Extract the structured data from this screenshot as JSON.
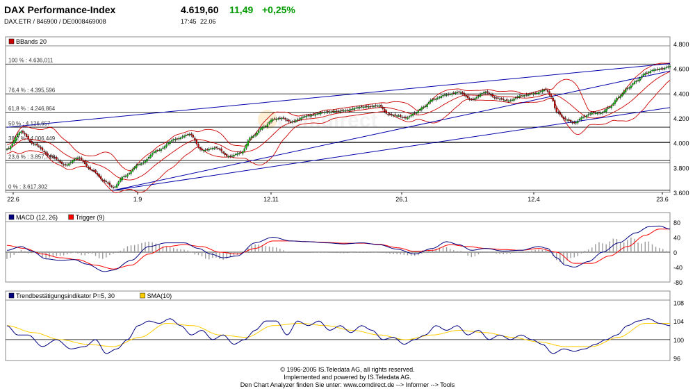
{
  "header": {
    "title": "DAX Performance-Index",
    "price": "4.619,60",
    "change": "11,49",
    "change_pct": "+0,25%",
    "ids": "DAX.ETR  /  846900  /  DE0008469008",
    "time": "17:45",
    "date": "22.06",
    "up_color": "#009900"
  },
  "footer": {
    "line1": "© 1996-2005 IS.Teledata AG, all rights reserved.",
    "line2": "Implemented and powered by IS.Teledata AG.",
    "line3": "Den Chart Analyzer finden Sie unter: www.comdirect.de --> Informer --> Tools"
  },
  "chart_data": [
    {
      "type": "candlestick",
      "legend": [
        "BBands 20"
      ],
      "legend_colors": [
        "#cc0000"
      ],
      "x_ticks": [
        "22.6",
        "1.9",
        "12.11",
        "26.1",
        "12.4",
        "23.6"
      ],
      "y_ticks": [
        "4.800",
        "4.600",
        "4.400",
        "4.200",
        "4.000",
        "3.800",
        "3.600"
      ],
      "ylim": [
        3600,
        4800
      ],
      "fib_levels": [
        {
          "label": "100 % : 4.636,011",
          "value": 4636.011
        },
        {
          "label": "76,4 % : 4.395,596",
          "value": 4395.596
        },
        {
          "label": "61,8 % : 4.246,864",
          "value": 4246.864
        },
        {
          "label": "50 % : 4.126,657",
          "value": 4126.657
        },
        {
          "label": "38,2 % : 4.006,449",
          "value": 4006.449
        },
        {
          "label": "23,6 % : 3.857,718",
          "value": 3857.718
        },
        {
          "label": "0 % : 3.617,302",
          "value": 3617.302
        }
      ],
      "close_keypoints": [
        [
          0,
          3950
        ],
        [
          8,
          4090
        ],
        [
          15,
          3990
        ],
        [
          25,
          3890
        ],
        [
          33,
          3820
        ],
        [
          40,
          3880
        ],
        [
          48,
          3780
        ],
        [
          55,
          3690
        ],
        [
          60,
          3640
        ],
        [
          66,
          3730
        ],
        [
          75,
          3830
        ],
        [
          85,
          3940
        ],
        [
          95,
          4030
        ],
        [
          103,
          4070
        ],
        [
          110,
          3940
        ],
        [
          118,
          3960
        ],
        [
          125,
          3890
        ],
        [
          132,
          3920
        ],
        [
          138,
          4050
        ],
        [
          145,
          4130
        ],
        [
          150,
          4190
        ],
        [
          155,
          4200
        ],
        [
          160,
          4170
        ],
        [
          170,
          4220
        ],
        [
          180,
          4250
        ],
        [
          190,
          4260
        ],
        [
          200,
          4290
        ],
        [
          210,
          4300
        ],
        [
          215,
          4230
        ],
        [
          220,
          4220
        ],
        [
          225,
          4200
        ],
        [
          230,
          4240
        ],
        [
          235,
          4290
        ],
        [
          240,
          4350
        ],
        [
          248,
          4390
        ],
        [
          255,
          4410
        ],
        [
          262,
          4350
        ],
        [
          270,
          4410
        ],
        [
          276,
          4360
        ],
        [
          283,
          4340
        ],
        [
          290,
          4380
        ],
        [
          298,
          4400
        ],
        [
          304,
          4430
        ],
        [
          307,
          4370
        ],
        [
          310,
          4250
        ],
        [
          315,
          4190
        ],
        [
          320,
          4160
        ],
        [
          325,
          4210
        ],
        [
          330,
          4240
        ],
        [
          335,
          4240
        ],
        [
          340,
          4290
        ],
        [
          345,
          4370
        ],
        [
          350,
          4440
        ],
        [
          355,
          4500
        ],
        [
          360,
          4560
        ],
        [
          365,
          4590
        ],
        [
          370,
          4600
        ],
        [
          374,
          4620
        ]
      ]
    },
    {
      "type": "line",
      "legend": [
        "MACD (12, 26)",
        "Trigger (9)"
      ],
      "legend_colors": [
        "#000080",
        "#ff0000"
      ],
      "y_ticks": [
        "80",
        "40",
        "0",
        "-40",
        "-80"
      ],
      "ylim": [
        -80,
        80
      ],
      "series": [
        {
          "name": "MACD (12, 26)",
          "color": "#000080",
          "keypoints": [
            [
              0,
              5
            ],
            [
              8,
              15
            ],
            [
              14,
              3
            ],
            [
              22,
              -18
            ],
            [
              30,
              -22
            ],
            [
              38,
              -20
            ],
            [
              45,
              -32
            ],
            [
              55,
              -52
            ],
            [
              60,
              -48
            ],
            [
              70,
              -22
            ],
            [
              80,
              15
            ],
            [
              90,
              25
            ],
            [
              100,
              25
            ],
            [
              108,
              10
            ],
            [
              115,
              -5
            ],
            [
              122,
              -15
            ],
            [
              130,
              -10
            ],
            [
              140,
              25
            ],
            [
              150,
              40
            ],
            [
              160,
              30
            ],
            [
              170,
              28
            ],
            [
              180,
              25
            ],
            [
              190,
              22
            ],
            [
              200,
              25
            ],
            [
              210,
              20
            ],
            [
              220,
              8
            ],
            [
              230,
              -5
            ],
            [
              240,
              10
            ],
            [
              248,
              28
            ],
            [
              255,
              20
            ],
            [
              262,
              5
            ],
            [
              270,
              10
            ],
            [
              280,
              3
            ],
            [
              290,
              5
            ],
            [
              300,
              15
            ],
            [
              305,
              10
            ],
            [
              310,
              -15
            ],
            [
              315,
              -35
            ],
            [
              320,
              -40
            ],
            [
              328,
              -25
            ],
            [
              336,
              0
            ],
            [
              345,
              25
            ],
            [
              355,
              52
            ],
            [
              362,
              68
            ],
            [
              368,
              70
            ],
            [
              374,
              62
            ]
          ]
        },
        {
          "name": "Trigger (9)",
          "color": "#ff0000",
          "keypoints": [
            [
              0,
              18
            ],
            [
              10,
              10
            ],
            [
              20,
              -5
            ],
            [
              30,
              -15
            ],
            [
              40,
              -20
            ],
            [
              50,
              -35
            ],
            [
              60,
              -45
            ],
            [
              70,
              -35
            ],
            [
              80,
              -5
            ],
            [
              90,
              15
            ],
            [
              100,
              20
            ],
            [
              110,
              15
            ],
            [
              120,
              0
            ],
            [
              130,
              -5
            ],
            [
              140,
              10
            ],
            [
              150,
              30
            ],
            [
              160,
              30
            ],
            [
              170,
              28
            ],
            [
              180,
              26
            ],
            [
              190,
              24
            ],
            [
              200,
              24
            ],
            [
              210,
              21
            ],
            [
              220,
              12
            ],
            [
              230,
              2
            ],
            [
              240,
              5
            ],
            [
              250,
              20
            ],
            [
              260,
              15
            ],
            [
              270,
              10
            ],
            [
              280,
              7
            ],
            [
              290,
              5
            ],
            [
              300,
              10
            ],
            [
              310,
              0
            ],
            [
              320,
              -30
            ],
            [
              330,
              -30
            ],
            [
              340,
              -10
            ],
            [
              350,
              15
            ],
            [
              360,
              45
            ],
            [
              368,
              62
            ],
            [
              374,
              62
            ]
          ]
        }
      ]
    },
    {
      "type": "line",
      "legend": [
        "Trendbestätigungsindikator P=5, 30",
        "SMA(10)"
      ],
      "legend_colors": [
        "#000080",
        "#ffcc00"
      ],
      "y_ticks": [
        "108",
        "104",
        "100",
        "96"
      ],
      "ylim": [
        95.5,
        108.5
      ],
      "series": [
        {
          "name": "Trendbestätigungsindikator P=5, 30",
          "color": "#000080",
          "keypoints": [
            [
              0,
              103
            ],
            [
              6,
              101
            ],
            [
              12,
              101
            ],
            [
              20,
              98.5
            ],
            [
              28,
              100
            ],
            [
              36,
              98
            ],
            [
              44,
              98.5
            ],
            [
              50,
              100
            ],
            [
              56,
              97
            ],
            [
              62,
              98
            ],
            [
              68,
              100
            ],
            [
              74,
              103
            ],
            [
              80,
              104
            ],
            [
              86,
              103.5
            ],
            [
              92,
              104.5
            ],
            [
              98,
              103
            ],
            [
              104,
              101
            ],
            [
              110,
              102
            ],
            [
              116,
              100
            ],
            [
              122,
              101
            ],
            [
              128,
              99
            ],
            [
              134,
              100
            ],
            [
              140,
              102
            ],
            [
              146,
              104
            ],
            [
              152,
              104
            ],
            [
              158,
              101
            ],
            [
              164,
              104
            ],
            [
              170,
              103
            ],
            [
              176,
              104
            ],
            [
              182,
              102
            ],
            [
              188,
              103
            ],
            [
              194,
              101.5
            ],
            [
              200,
              103
            ],
            [
              206,
              102
            ],
            [
              212,
              100
            ],
            [
              218,
              100.5
            ],
            [
              224,
              99
            ],
            [
              230,
              100
            ],
            [
              236,
              101
            ],
            [
              242,
              103
            ],
            [
              248,
              102
            ],
            [
              254,
              103
            ],
            [
              260,
              101
            ],
            [
              266,
              102
            ],
            [
              272,
              100
            ],
            [
              278,
              101
            ],
            [
              284,
              100
            ],
            [
              290,
              101
            ],
            [
              296,
              100
            ],
            [
              302,
              99
            ],
            [
              308,
              97
            ],
            [
              314,
              98
            ],
            [
              320,
              97.5
            ],
            [
              326,
              98
            ],
            [
              332,
              99
            ],
            [
              338,
              100
            ],
            [
              344,
              101
            ],
            [
              350,
              103
            ],
            [
              356,
              104
            ],
            [
              362,
              104.5
            ],
            [
              368,
              103.5
            ],
            [
              374,
              103
            ]
          ]
        },
        {
          "name": "SMA(10)",
          "color": "#ffcc00",
          "keypoints": [
            [
              0,
              103
            ],
            [
              15,
              101.5
            ],
            [
              30,
              100
            ],
            [
              45,
              99
            ],
            [
              60,
              98.5
            ],
            [
              75,
              100.5
            ],
            [
              90,
              103.5
            ],
            [
              105,
              103
            ],
            [
              120,
              101
            ],
            [
              135,
              100.5
            ],
            [
              150,
              103
            ],
            [
              165,
              103.5
            ],
            [
              180,
              103
            ],
            [
              195,
              102
            ],
            [
              210,
              101
            ],
            [
              225,
              100
            ],
            [
              240,
              101
            ],
            [
              255,
              102
            ],
            [
              270,
              101.5
            ],
            [
              285,
              100.5
            ],
            [
              300,
              99.5
            ],
            [
              315,
              98.5
            ],
            [
              330,
              98.5
            ],
            [
              345,
              100.5
            ],
            [
              360,
              103.5
            ],
            [
              374,
              103.5
            ]
          ]
        }
      ]
    }
  ]
}
